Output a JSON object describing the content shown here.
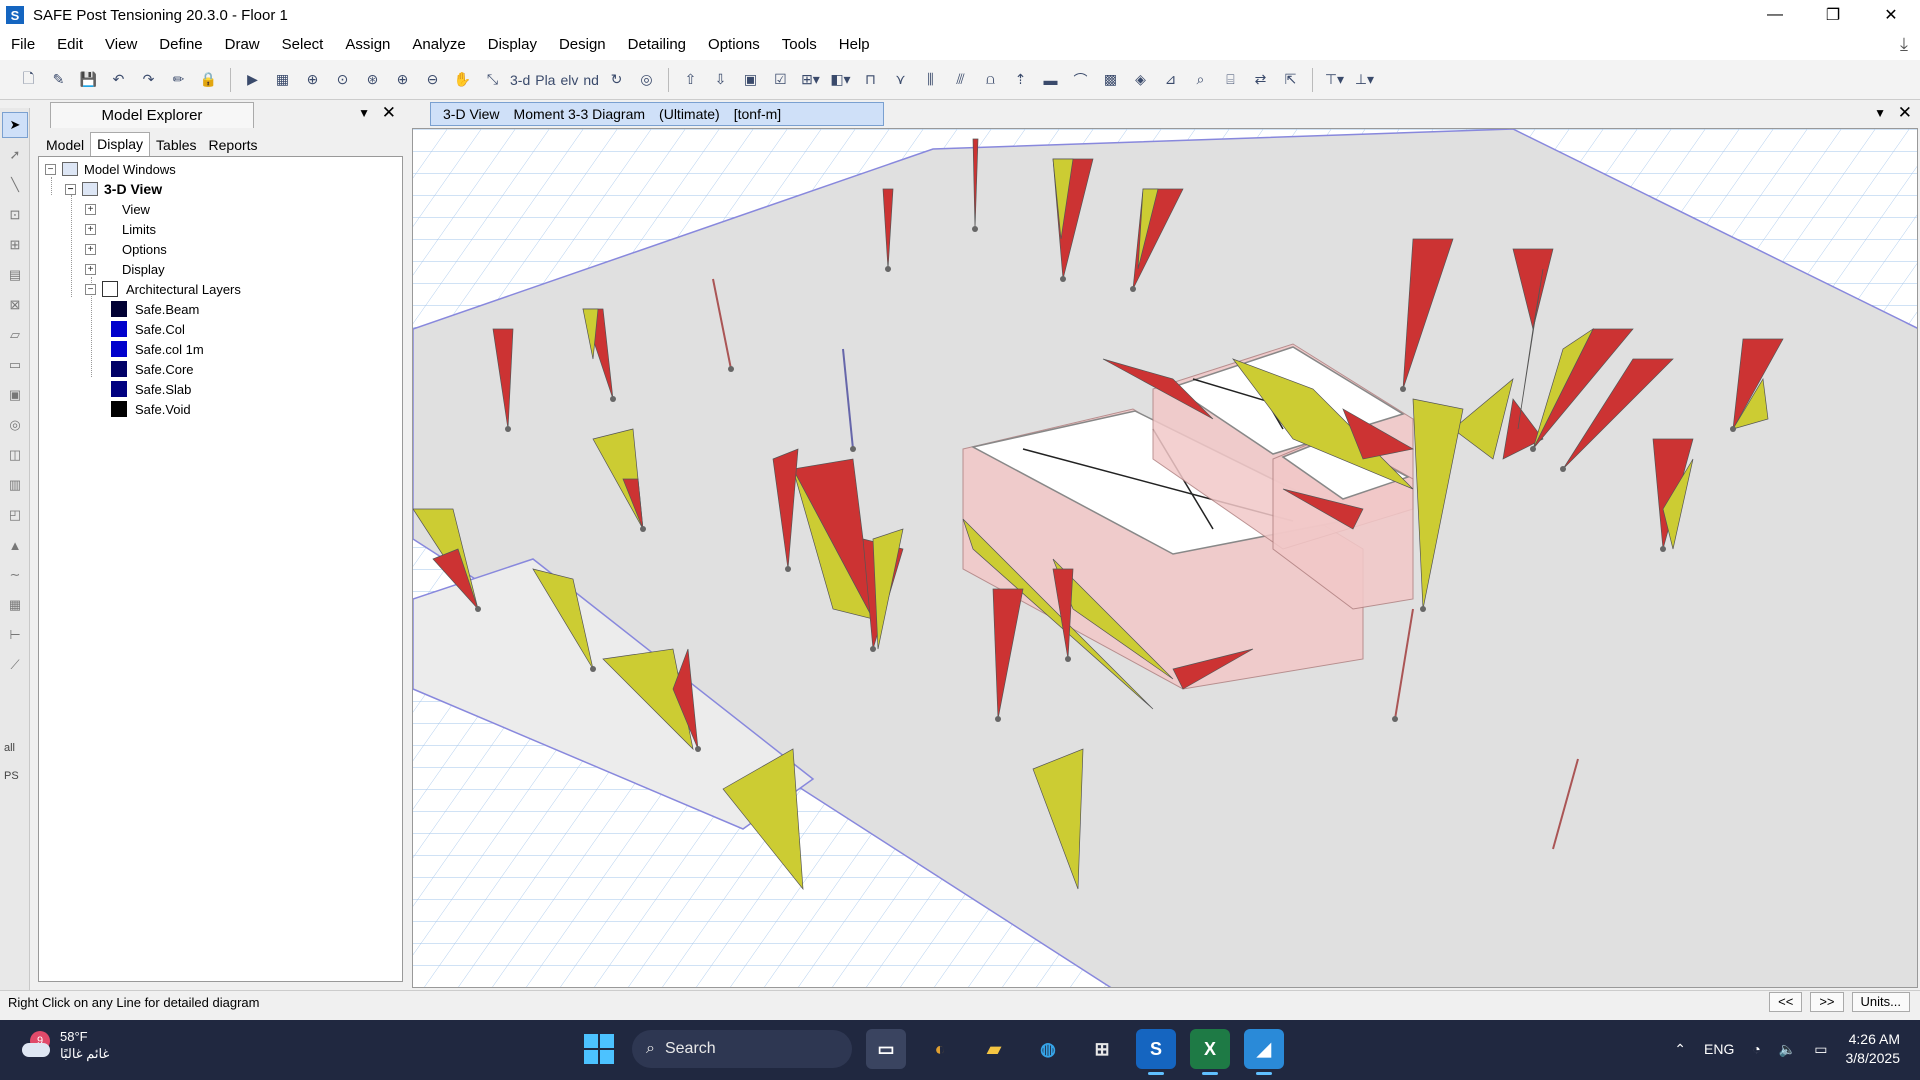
{
  "window": {
    "title": "SAFE Post Tensioning 20.3.0 - Floor 1",
    "app_icon_letter": "S",
    "controls": [
      "—",
      "❐",
      "✕"
    ]
  },
  "menu": [
    "File",
    "Edit",
    "View",
    "Define",
    "Draw",
    "Select",
    "Assign",
    "Analyze",
    "Display",
    "Design",
    "Detailing",
    "Options",
    "Tools",
    "Help"
  ],
  "toolbar": {
    "view_3d_label": "3-d",
    "plan_label": "Pla",
    "elev_label": "elv",
    "nd_label": "nd"
  },
  "left_tools": {
    "all_label": "all",
    "ps_label": "PS"
  },
  "explorer": {
    "title": "Model Explorer",
    "tabs": [
      "Model",
      "Display",
      "Tables",
      "Reports"
    ],
    "active_tab": "Display",
    "tree": {
      "root": "Model Windows",
      "view": "3-D View",
      "children": [
        "View",
        "Limits",
        "Options",
        "Display",
        "Architectural Layers"
      ],
      "layers": [
        {
          "name": "Safe.Beam",
          "color": "#000033"
        },
        {
          "name": "Safe.Col",
          "color": "#0000cc"
        },
        {
          "name": "Safe.col 1m",
          "color": "#0000cc"
        },
        {
          "name": "Safe.Core",
          "color": "#000066"
        },
        {
          "name": "Safe.Slab",
          "color": "#000080"
        },
        {
          "name": "Safe.Void",
          "color": "#000000"
        }
      ]
    }
  },
  "viewport": {
    "tab_view": "3-D View",
    "tab_diagram": "Moment 3-3 Diagram",
    "tab_combo": "(Ultimate)",
    "tab_units": "[tonf-m]"
  },
  "diagram_colors": {
    "positive": "#cc3333",
    "negative": "#cccc33",
    "grid": "#a8c8ec",
    "slab": "#e0e0e0",
    "core": "#f2c8c8"
  },
  "status": {
    "message": "Right Click on any Line for detailed diagram",
    "prev": "<<",
    "next": ">>",
    "units": "Units..."
  },
  "taskbar": {
    "weather_badge": "9",
    "temperature": "58°F",
    "weather_caption": "غائم غالبًا",
    "search": "Search",
    "language": "ENG",
    "time": "4:26 AM",
    "date": "3/8/2025"
  }
}
